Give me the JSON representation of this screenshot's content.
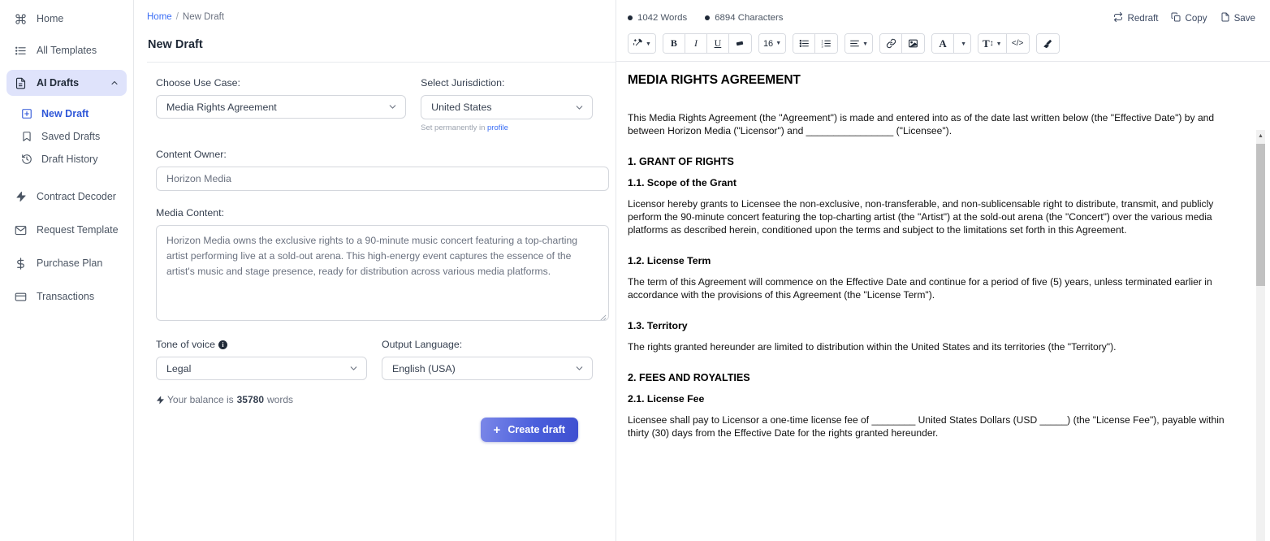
{
  "sidebar": {
    "items": [
      {
        "label": "Home",
        "icon": "command-icon"
      },
      {
        "label": "All Templates",
        "icon": "list-icon"
      },
      {
        "label": "AI Drafts",
        "icon": "document-icon",
        "active": true
      }
    ],
    "sub_items": [
      {
        "label": "New Draft",
        "icon": "plus-square-icon"
      },
      {
        "label": "Saved Drafts",
        "icon": "bookmark-icon"
      },
      {
        "label": "Draft History",
        "icon": "history-icon"
      }
    ],
    "lower_items": [
      {
        "label": "Contract Decoder",
        "icon": "bolt-icon"
      },
      {
        "label": "Request Template",
        "icon": "envelope-icon"
      },
      {
        "label": "Purchase Plan",
        "icon": "dollar-icon"
      },
      {
        "label": "Transactions",
        "icon": "card-icon"
      }
    ],
    "active_accent": "#dfe3fb",
    "highlight_color": "#2f57d8"
  },
  "breadcrumb": {
    "home": "Home",
    "separator": "/",
    "current": "New Draft"
  },
  "page_title": "New Draft",
  "form": {
    "use_case_label": "Choose Use Case:",
    "use_case_value": "Media Rights Agreement",
    "jurisdiction_label": "Select Jurisdiction:",
    "jurisdiction_value": "United States",
    "jurisdiction_hint_prefix": "Set permanently in ",
    "jurisdiction_hint_link": "profile",
    "content_owner_label": "Content Owner:",
    "content_owner_value": "Horizon Media",
    "media_content_label": "Media Content:",
    "media_content_value": " Horizon Media owns the exclusive rights to a 90-minute music concert featuring a top-charting artist performing live at a sold-out arena. This high-energy event captures the essence of the artist's music and stage presence, ready for distribution across various media platforms.",
    "tone_label": "Tone of voice",
    "tone_value": "Legal",
    "language_label": "Output Language:",
    "language_value": "English (USA)",
    "balance_prefix": "Your balance is",
    "balance_amount": "35780",
    "balance_suffix": "words",
    "create_button": "Create draft",
    "create_button_plus": "+"
  },
  "editor": {
    "word_count": "1042 Words",
    "char_count": "6894 Characters",
    "actions": [
      {
        "label": "Redraft",
        "icon": "redraft-icon"
      },
      {
        "label": "Copy",
        "icon": "copy-icon"
      },
      {
        "label": "Save",
        "icon": "save-icon"
      }
    ],
    "toolbar": [
      {
        "name": "magic-wand-icon",
        "glyph": "✨",
        "dropdown": true
      },
      {
        "name": "bold-button",
        "glyph": "B",
        "dropdown": false
      },
      {
        "name": "italic-button",
        "glyph": "I",
        "dropdown": false
      },
      {
        "name": "underline-button",
        "glyph": "U",
        "dropdown": false
      },
      {
        "name": "highlight-icon",
        "glyph": "▰",
        "dropdown": false
      },
      {
        "name": "font-size-select",
        "glyph": "16",
        "dropdown": true
      },
      {
        "name": "bullet-list-icon",
        "glyph": "≔",
        "dropdown": false
      },
      {
        "name": "numbered-list-icon",
        "glyph": "≕",
        "dropdown": false
      },
      {
        "name": "align-icon",
        "glyph": "≡",
        "dropdown": true
      },
      {
        "name": "link-icon",
        "glyph": "🔗",
        "dropdown": false
      },
      {
        "name": "image-icon",
        "glyph": "🖼",
        "dropdown": false
      },
      {
        "name": "font-color-icon",
        "glyph": "A",
        "dropdown": false
      },
      {
        "name": "font-color-caret",
        "glyph": "",
        "dropdown": true
      },
      {
        "name": "line-height-icon",
        "glyph": "T↕",
        "dropdown": true
      },
      {
        "name": "code-icon",
        "glyph": "</>",
        "dropdown": false
      },
      {
        "name": "clear-format-icon",
        "glyph": "◣",
        "dropdown": false
      }
    ]
  },
  "document": {
    "title": "MEDIA RIGHTS AGREEMENT",
    "intro": "This Media Rights Agreement (the \"Agreement\") is made and entered into as of the date last written below (the \"Effective Date\") by and between Horizon Media (\"Licensor\") and ________________ (\"Licensee\").",
    "h_grant": "1. GRANT OF RIGHTS",
    "h_scope": "1.1. Scope of the Grant",
    "p_scope": "Licensor hereby grants to Licensee the non-exclusive, non-transferable, and non-sublicensable right to distribute, transmit, and publicly perform the 90-minute concert featuring the top-charting artist (the \"Artist\") at the sold-out arena (the \"Concert\") over the various media platforms as described herein, conditioned upon the terms and subject to the limitations set forth in this Agreement.",
    "h_term": "1.2. License Term",
    "p_term": "The term of this Agreement will commence on the Effective Date and continue for a period of five (5) years, unless terminated earlier in accordance with the provisions of this Agreement (the \"License Term\").",
    "h_territory": "1.3. Territory",
    "p_territory": "The rights granted hereunder are limited to distribution within the United States and its territories (the \"Territory\").",
    "h_fees": "2. FEES AND ROYALTIES",
    "h_license_fee": "2.1. License Fee",
    "p_license_fee": "Licensee shall pay to Licensor a one-time license fee of ________ United States Dollars (USD _____) (the \"License Fee\"), payable within thirty (30) days from the Effective Date for the rights granted hereunder."
  }
}
